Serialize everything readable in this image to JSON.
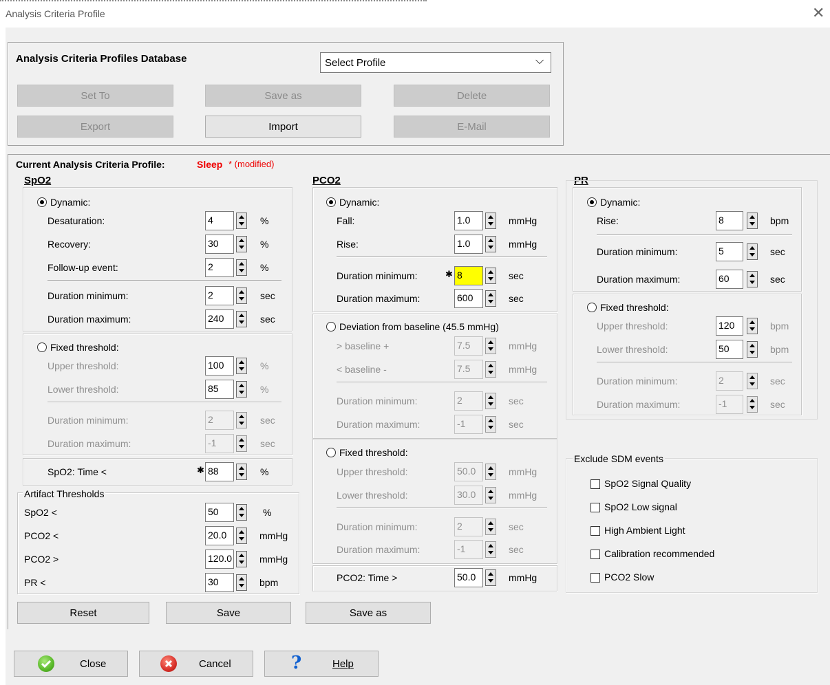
{
  "window": {
    "title": "Analysis Criteria Profile"
  },
  "db": {
    "heading": "Analysis Criteria Profiles Database",
    "select_value": "Select Profile",
    "buttons": {
      "set_to": "Set To",
      "save_as": "Save as",
      "delete": "Delete",
      "export": "Export",
      "import": "Import",
      "email": "E-Mail"
    }
  },
  "current": {
    "label": "Current Analysis Criteria Profile:",
    "profile": "Sleep",
    "modified": "* (modified)"
  },
  "spo2": {
    "heading": "SpO2",
    "dynamic_label": "Dynamic:",
    "desaturation": {
      "label": "Desaturation:",
      "value": "4",
      "unit": "%"
    },
    "recovery": {
      "label": "Recovery:",
      "value": "30",
      "unit": "%"
    },
    "followup": {
      "label": "Follow-up event:",
      "value": "2",
      "unit": "%"
    },
    "dur_min": {
      "label": "Duration minimum:",
      "value": "2",
      "unit": "sec"
    },
    "dur_max": {
      "label": "Duration maximum:",
      "value": "240",
      "unit": "sec"
    },
    "fixed_label": "Fixed threshold:",
    "upper": {
      "label": "Upper threshold:",
      "value": "100",
      "unit": "%"
    },
    "lower": {
      "label": "Lower threshold:",
      "value": "85",
      "unit": "%"
    },
    "fdur_min": {
      "label": "Duration minimum:",
      "value": "2",
      "unit": "sec"
    },
    "fdur_max": {
      "label": "Duration maximum:",
      "value": "-1",
      "unit": "sec"
    },
    "time": {
      "label": "SpO2: Time <",
      "value": "88",
      "unit": "%"
    }
  },
  "artifact": {
    "heading": "Artifact Thresholds",
    "spo2": {
      "label": "SpO2 <",
      "value": "50",
      "unit": "%"
    },
    "pco2_lt": {
      "label": "PCO2 <",
      "value": "20.0",
      "unit": "mmHg"
    },
    "pco2_gt": {
      "label": "PCO2 >",
      "value": "120.0",
      "unit": "mmHg"
    },
    "pr": {
      "label": "PR <",
      "value": "30",
      "unit": "bpm"
    }
  },
  "pco2": {
    "heading": "PCO2",
    "dynamic_label": "Dynamic:",
    "fall": {
      "label": "Fall:",
      "value": "1.0",
      "unit": "mmHg"
    },
    "rise": {
      "label": "Rise:",
      "value": "1.0",
      "unit": "mmHg"
    },
    "dur_min": {
      "label": "Duration minimum:",
      "value": "8",
      "unit": "sec"
    },
    "dur_max": {
      "label": "Duration maximum:",
      "value": "600",
      "unit": "sec"
    },
    "deviation_label": "Deviation from baseline (45.5 mmHg)",
    "base_plus": {
      "label": "> baseline +",
      "value": "7.5",
      "unit": "mmHg"
    },
    "base_minus": {
      "label": "< baseline -",
      "value": "7.5",
      "unit": "mmHg"
    },
    "ddur_min": {
      "label": "Duration minimum:",
      "value": "2",
      "unit": "sec"
    },
    "ddur_max": {
      "label": "Duration maximum:",
      "value": "-1",
      "unit": "sec"
    },
    "fixed_label": "Fixed threshold:",
    "upper": {
      "label": "Upper threshold:",
      "value": "50.0",
      "unit": "mmHg"
    },
    "lower": {
      "label": "Lower threshold:",
      "value": "30.0",
      "unit": "mmHg"
    },
    "fdur_min": {
      "label": "Duration minimum:",
      "value": "2",
      "unit": "sec"
    },
    "fdur_max": {
      "label": "Duration maximum:",
      "value": "-1",
      "unit": "sec"
    },
    "time": {
      "label": "PCO2: Time >",
      "value": "50.0",
      "unit": "mmHg"
    }
  },
  "pr": {
    "heading": "PR",
    "dynamic_label": "Dynamic:",
    "rise": {
      "label": "Rise:",
      "value": "8",
      "unit": "bpm"
    },
    "dur_min": {
      "label": "Duration minimum:",
      "value": "5",
      "unit": "sec"
    },
    "dur_max": {
      "label": "Duration maximum:",
      "value": "60",
      "unit": "sec"
    },
    "fixed_label": "Fixed threshold:",
    "upper": {
      "label": "Upper threshold:",
      "value": "120",
      "unit": "bpm"
    },
    "lower": {
      "label": "Lower threshold:",
      "value": "50",
      "unit": "bpm"
    },
    "fdur_min": {
      "label": "Duration minimum:",
      "value": "2",
      "unit": "sec"
    },
    "fdur_max": {
      "label": "Duration maximum:",
      "value": "-1",
      "unit": "sec"
    }
  },
  "exclude": {
    "heading": "Exclude SDM events",
    "items": [
      "SpO2 Signal Quality",
      "SpO2 Low signal",
      "High Ambient Light",
      "Calibration recommended",
      "PCO2 Slow"
    ]
  },
  "profile_buttons": {
    "reset": "Reset",
    "save": "Save",
    "save_as": "Save as"
  },
  "footer": {
    "close": "Close",
    "cancel": "Cancel",
    "help": "Help"
  },
  "colors": {
    "accent_red": "#ee0000",
    "highlight": "#ffff00",
    "help_blue": "#1060d0",
    "ok_green": "#58b828",
    "cancel_red": "#d8302a"
  },
  "icons": {
    "close": "check-icon",
    "cancel": "x-icon",
    "help": "question-icon"
  }
}
